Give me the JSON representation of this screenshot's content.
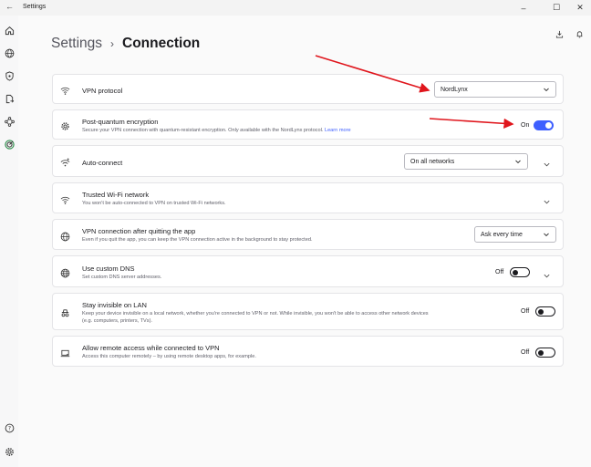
{
  "window": {
    "title": "Settings",
    "back_glyph": "←",
    "minimize": "–",
    "maximize": "☐",
    "close": "✕"
  },
  "breadcrumb": {
    "parent": "Settings",
    "separator": "›",
    "current": "Connection"
  },
  "rail": {
    "icons": [
      "home-icon",
      "globe-icon",
      "shield-icon",
      "file-share-icon",
      "meshnet-icon",
      "threat-protection-icon"
    ],
    "bottom_icons": [
      "help-icon",
      "settings-gear-icon"
    ]
  },
  "toolbar_icons": [
    "download-icon",
    "notification-bell-icon"
  ],
  "settings": {
    "vpn_protocol": {
      "title": "VPN protocol",
      "value": "NordLynx"
    },
    "post_quantum": {
      "title": "Post-quantum encryption",
      "subtitle": "Secure your VPN connection with quantum-resistant encryption. Only available with the NordLynx protocol.",
      "link": "Learn more",
      "state_label": "On",
      "enabled": true
    },
    "auto_connect": {
      "title": "Auto-connect",
      "value": "On all networks"
    },
    "trusted_wifi": {
      "title": "Trusted Wi-Fi network",
      "subtitle": "You won't be auto-connected to VPN on trusted Wi-Fi networks."
    },
    "after_quit": {
      "title": "VPN connection after quitting the app",
      "subtitle": "Even if you quit the app, you can keep the VPN connection active in the background to stay protected.",
      "value": "Ask every time"
    },
    "custom_dns": {
      "title": "Use custom DNS",
      "subtitle": "Set custom DNS server addresses.",
      "state_label": "Off",
      "enabled": false
    },
    "invisible_lan": {
      "title": "Stay invisible on LAN",
      "subtitle_line1": "Keep your device invisible on a local network, whether you're connected to VPN or not. While invisible, you won't be able to access other network devices",
      "subtitle_line2": "(e.g. computers, printers, TVs).",
      "state_label": "Off",
      "enabled": false
    },
    "remote_access": {
      "title": "Allow remote access while connected to VPN",
      "subtitle": "Access this computer remotely – by using remote desktop apps, for example.",
      "state_label": "Off",
      "enabled": false
    }
  },
  "colors": {
    "accent": "#3e5fff",
    "annotation_arrow": "#e0161d"
  }
}
